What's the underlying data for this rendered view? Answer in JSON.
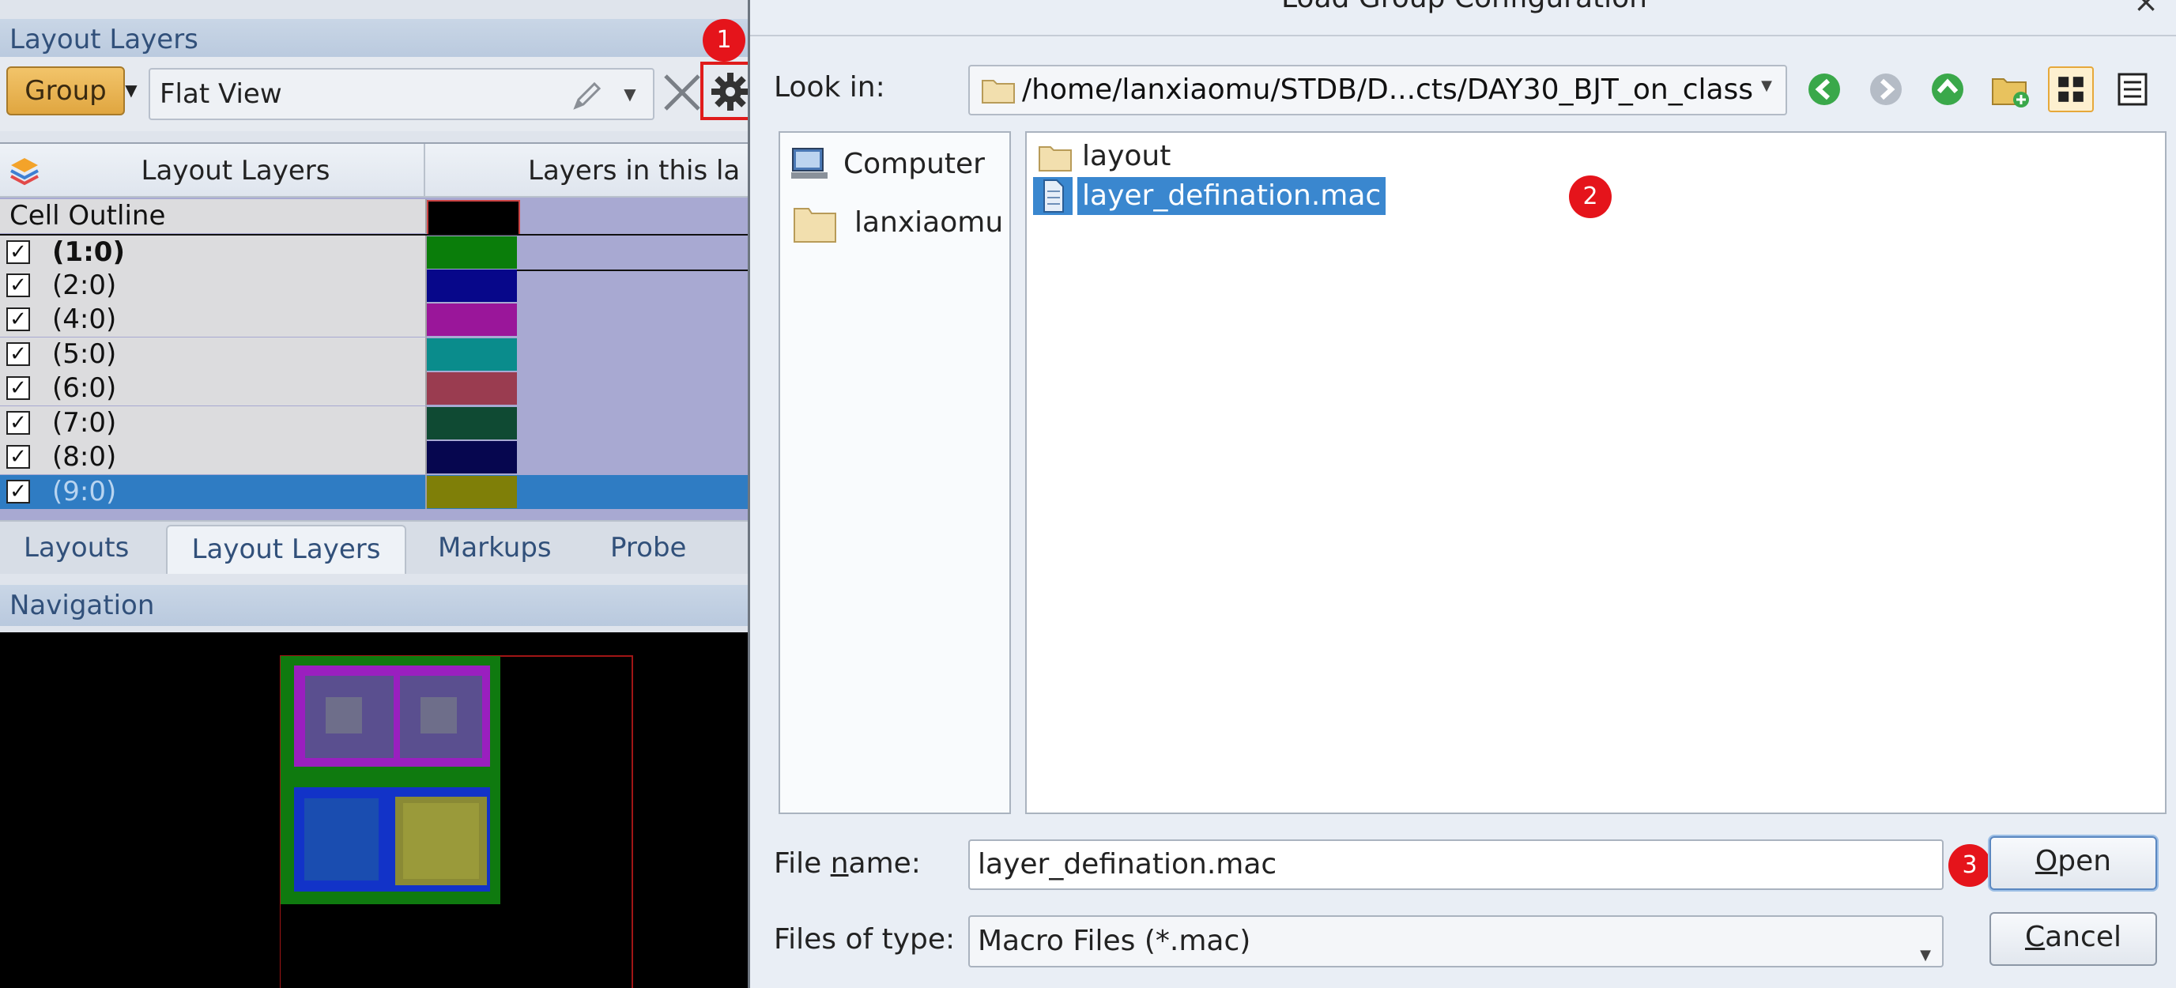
{
  "left_panel": {
    "layers_panel_title": "Layout Layers",
    "group_button": "Group",
    "view_value": "Flat View",
    "table": {
      "col_layers": "Layout Layers",
      "col_in_layout": "Layers in this la",
      "cell_outline": "Cell Outline",
      "rows": [
        {
          "label": "(1:0)",
          "checked": true,
          "color": "#0a7d0a",
          "bold": true
        },
        {
          "label": "(2:0)",
          "checked": true,
          "color": "#07078a"
        },
        {
          "label": "(4:0)",
          "checked": true,
          "color": "#9a169a"
        },
        {
          "label": "(5:0)",
          "checked": true,
          "color": "#0a8c8c"
        },
        {
          "label": "(6:0)",
          "checked": true,
          "color": "#9a3c50"
        },
        {
          "label": "(7:0)",
          "checked": true,
          "color": "#0f4a33"
        },
        {
          "label": "(8:0)",
          "checked": true,
          "color": "#06064f"
        },
        {
          "label": "(9:0)",
          "checked": true,
          "color": "#7f7f08",
          "selected": true
        }
      ]
    },
    "tabs": [
      "Layouts",
      "Layout Layers",
      "Markups",
      "Probe"
    ],
    "active_tab": "Layout Layers",
    "navigation_title": "Navigation"
  },
  "dialog": {
    "title": "Load Group Configuration",
    "look_in_label": "Look in:",
    "look_in_path": "/home/lanxiaomu/STDB/D...cts/DAY30_BJT_on_class",
    "places": [
      "Computer",
      "lanxiaomu"
    ],
    "files": [
      {
        "name": "layout",
        "type": "folder"
      },
      {
        "name": "layer_defination.mac",
        "type": "file",
        "selected": true
      }
    ],
    "file_name_label_pre": "File ",
    "file_name_label_u": "n",
    "file_name_label_post": "ame:",
    "file_name_value": "layer_defination.mac",
    "files_of_type_label": "Files of type:",
    "files_of_type_value": "Macro Files (*.mac)",
    "open_u": "O",
    "open_rest": "pen",
    "cancel_u": "C",
    "cancel_rest": "ancel",
    "close_glyph": "×"
  },
  "annotations": [
    "1",
    "2",
    "3"
  ]
}
